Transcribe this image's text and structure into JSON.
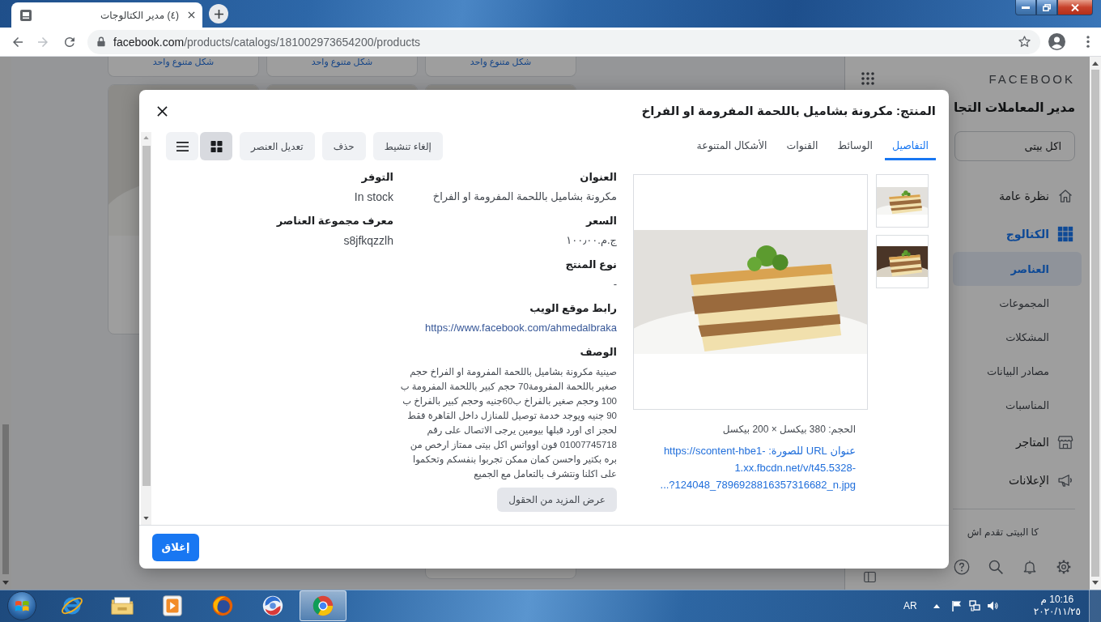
{
  "browser": {
    "tabs": [
      {
        "title": "(٤) مدير الكتالوجات",
        "selected": true
      }
    ],
    "forward_disabled": true,
    "address": {
      "host": "facebook.com",
      "path": "/products/catalogs/181002973654200/products"
    }
  },
  "page": {
    "variant_links": [
      "شكل متنوع واحد",
      "شكل متنوع واحد",
      "شكل متنوع واحد"
    ]
  },
  "sidebar": {
    "brand": "FACEBOOK",
    "title": "مدير المعاملات التجا",
    "account": "اكل بيتى",
    "items": [
      {
        "label": "نظرة عامة",
        "selected": false
      },
      {
        "label": "الكتالوج",
        "selected": true,
        "children": [
          {
            "label": "العناصر",
            "selected": true
          },
          {
            "label": "المجموعات",
            "selected": false
          },
          {
            "label": "المشكلات",
            "selected": false
          },
          {
            "label": "مصادر البيانات",
            "selected": false
          },
          {
            "label": "المناسبات",
            "selected": false
          }
        ]
      },
      {
        "label": "المتاجر",
        "selected": false
      },
      {
        "label": "الإعلانات",
        "selected": false
      }
    ],
    "footer_text": "كا البيتى تقدم اش"
  },
  "modal": {
    "title": "المنتج: مكرونة بشاميل باللحمة المفرومة او الفراخ",
    "tabs": [
      {
        "label": "التفاصيل",
        "selected": true
      },
      {
        "label": "الوسائط",
        "selected": false
      },
      {
        "label": "القنوات",
        "selected": false
      },
      {
        "label": "الأشكال المتنوعة",
        "selected": false
      }
    ],
    "actions": [
      "إلغاء تنشيط",
      "حذف",
      "تعديل العنصر"
    ],
    "views": [
      {
        "kind": "grid",
        "selected": true
      },
      {
        "kind": "list",
        "selected": false
      }
    ],
    "image": {
      "size": "الحجم: 380 بيكسل × 200 بيكسل",
      "url": "عنوان URL للصورة: https://scontent-hbe1-1.xx.fbcdn.net/v/t45.5328-124048_7896928816357316682_n.jpg?..."
    },
    "fields": [
      {
        "kind": "text",
        "label": "العنوان",
        "value": "مكرونة بشاميل باللحمة المفرومة او الفراخ"
      },
      {
        "kind": "text",
        "label": "السعر",
        "value": "ج.م.١٠٠٫٠٠"
      },
      {
        "kind": "text",
        "label": "نوع المنتج",
        "value": "-"
      },
      {
        "kind": "link",
        "label": "رابط موقع الويب",
        "value": "https://www.facebook.com/ahmedalbraka"
      },
      {
        "kind": "paragraph",
        "label": "الوصف",
        "value": "صينية مكرونة بشاميل باللحمة المفرومة او الفراخ حجم صغير باللحمة المفرومة70 حجم كبير باللحمة المفرومة ب 100 وحجم صغير بالفراخ ب60جنيه وحجم كبير بالفراخ ب 90 جنيه ويوجد خدمة توصيل للمنازل داخل القاهرة فقط لحجز اى اورد قبلها بيومين يرجى الاتصال على رقم 01007745718 فون اوواتس اكل بيتى ممتاز ارخص من بره بكتير واحسن كمان ممكن تجربوا بنفسكم وتحكموا على اكلنا ونتشرف بالتعامل مع الجميع"
      }
    ],
    "side_fields": [
      {
        "label": "التوفر",
        "value": "In stock"
      },
      {
        "label": "معرف مجموعة العناصر",
        "value": "s8jfkqzzlh"
      }
    ],
    "more_button": "عرض المزيد من الحقول",
    "close_button": "إغلاق"
  },
  "taskbar": {
    "apps": [
      {
        "selected": false
      },
      {
        "selected": false
      },
      {
        "selected": false
      },
      {
        "selected": false
      },
      {
        "selected": false
      },
      {
        "selected": true
      }
    ],
    "language": "AR",
    "time": "10:16 م",
    "date": "٢٠٢٠/١١/٢٥"
  }
}
